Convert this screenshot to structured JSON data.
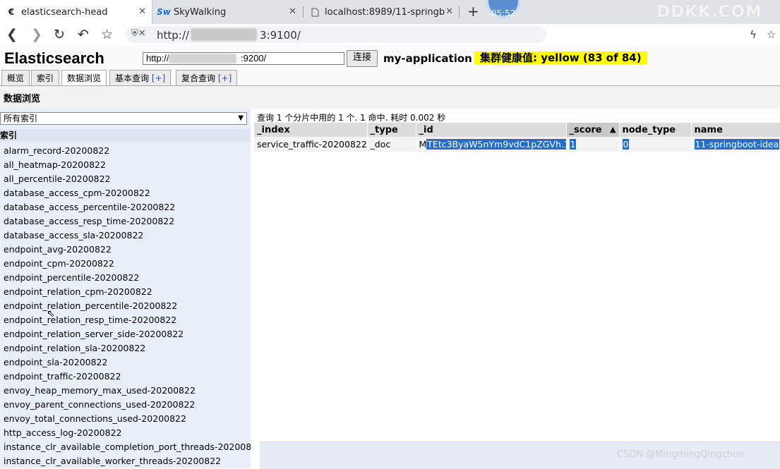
{
  "browser": {
    "tabs": [
      {
        "favicon": "elasticsearch-head-icon",
        "title": "elasticsearch-head",
        "active": true
      },
      {
        "favicon": "skywalking-icon",
        "title": "SkyWalking",
        "active": false
      },
      {
        "favicon": "page-icon",
        "title": "localhost:8989/11-springbo",
        "active": false
      }
    ],
    "new_tab_glyph": "+",
    "clock": "05:52",
    "watermark": "DDKK.COM",
    "address": {
      "prefix": "http://",
      "suffix": "3:9100/"
    }
  },
  "eshead": {
    "logo": "Elasticsearch",
    "connect_url": "http://",
    "connect_url_tail": ":9200/",
    "connect_button": "连接",
    "cluster_name": "my-application",
    "health": "集群健康值: yellow (83 of 84)",
    "nav_tabs": [
      {
        "label": "概览",
        "plus": ""
      },
      {
        "label": "索引",
        "plus": ""
      },
      {
        "label": "数据浏览",
        "plus": "",
        "active": true
      },
      {
        "label": "基本查询",
        "plus": "[+]"
      },
      {
        "label": "复合查询",
        "plus": "[+]"
      }
    ],
    "section_title": "数据浏览"
  },
  "sidebar": {
    "select_value": "所有索引",
    "section_header": "索引",
    "indices": [
      "alarm_record-20200822",
      "all_heatmap-20200822",
      "all_percentile-20200822",
      "database_access_cpm-20200822",
      "database_access_percentile-20200822",
      "database_access_resp_time-20200822",
      "database_access_sla-20200822",
      "endpoint_avg-20200822",
      "endpoint_cpm-20200822",
      "endpoint_percentile-20200822",
      "endpoint_relation_cpm-20200822",
      "endpoint_relation_percentile-20200822",
      "endpoint_relation_resp_time-20200822",
      "endpoint_relation_server_side-20200822",
      "endpoint_relation_sla-20200822",
      "endpoint_sla-20200822",
      "endpoint_traffic-20200822",
      "envoy_heap_memory_max_used-20200822",
      "envoy_parent_connections_used-20200822",
      "envoy_total_connections_used-20200822",
      "http_access_log-20200822",
      "instance_clr_available_completion_port_threads-202008",
      "instance_clr_available_worker_threads-20200822"
    ]
  },
  "results": {
    "summary": "查询 1 个分片中用的 1 个. 1 命中. 耗时 0.002 秒",
    "columns": [
      "_index",
      "_type",
      "_id",
      "_score",
      "node_type",
      "name"
    ],
    "sort_indicator": "▲",
    "rows": [
      {
        "_index": "service_traffic-20200822",
        "_type": "_doc",
        "_id_prefix": "M",
        "_id": "TEtc3ByaW5nYm9vdC1pZGVh.1",
        "_score": "1",
        "node_type": "0",
        "name": "11-springboot-idea"
      }
    ]
  },
  "footer_watermark": "CSDN @MingmingQingchun"
}
